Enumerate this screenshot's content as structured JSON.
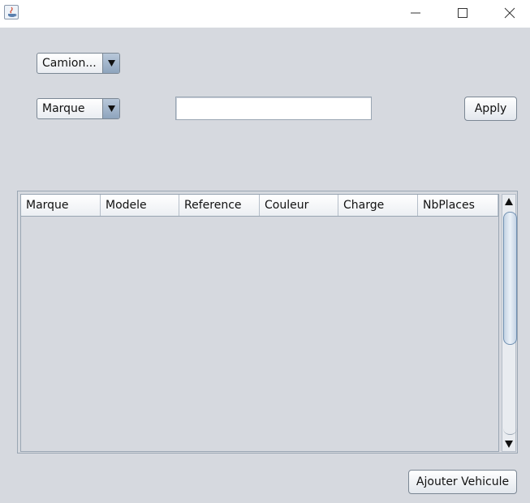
{
  "window": {
    "title": "",
    "icons": {
      "app": "java-cup-icon",
      "minimize": "minimize-icon",
      "maximize": "maximize-icon",
      "close": "close-icon"
    }
  },
  "filters": {
    "vehicle_type": {
      "selected": "Camion..."
    },
    "search_field": {
      "selected": "Marque"
    },
    "search_text": {
      "value": ""
    },
    "apply_label": "Apply"
  },
  "table": {
    "columns": [
      "Marque",
      "Modele",
      "Reference",
      "Couleur",
      "Charge",
      "NbPlaces"
    ],
    "rows": []
  },
  "actions": {
    "add_vehicle_label": "Ajouter Vehicule"
  },
  "colors": {
    "background": "#d6d9df",
    "accent": "#8ea4bd"
  }
}
